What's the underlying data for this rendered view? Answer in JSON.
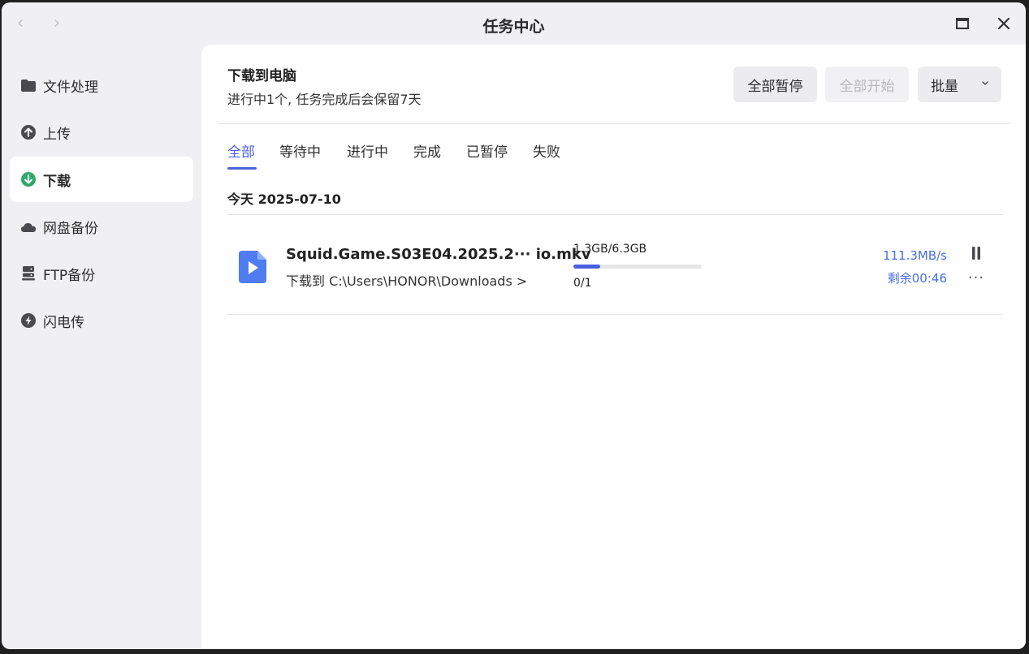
{
  "window": {
    "title": "任务中心",
    "nav_back": "‹",
    "nav_forward": "›"
  },
  "sidebar": {
    "items": [
      {
        "label": "文件处理",
        "icon": "folder-icon"
      },
      {
        "label": "上传",
        "icon": "upload-icon"
      },
      {
        "label": "下载",
        "icon": "download-icon",
        "active": true
      },
      {
        "label": "网盘备份",
        "icon": "cloud-icon"
      },
      {
        "label": "FTP备份",
        "icon": "server-icon"
      },
      {
        "label": "闪电传",
        "icon": "lightning-icon"
      }
    ]
  },
  "main": {
    "title": "下载到电脑",
    "subtitle": "进行中1个, 任务完成后会保留7天",
    "buttons": {
      "pause_all": "全部暂停",
      "start_all": "全部开始",
      "batch": "批量"
    },
    "tabs": [
      "全部",
      "等待中",
      "进行中",
      "完成",
      "已暂停",
      "失败"
    ],
    "active_tab": 0,
    "date_group": "今天 2025-07-10",
    "tasks": [
      {
        "file_name": "Squid.Game.S03E04.2025.2··· io.mkv",
        "destination": "下载到 C:\\Users\\HONOR\\Downloads >",
        "size": "1.3GB/6.3GB",
        "progress": 0.206,
        "count": "0/1",
        "speed": "111.3MB/s",
        "remaining": "剩余00:46",
        "more": "···"
      }
    ]
  },
  "colors": {
    "accent": "#4a63d9",
    "speed_text": "#4a6de0",
    "sidebar_bg": "#f0f0f2",
    "active_icon": "#2fa86a"
  }
}
